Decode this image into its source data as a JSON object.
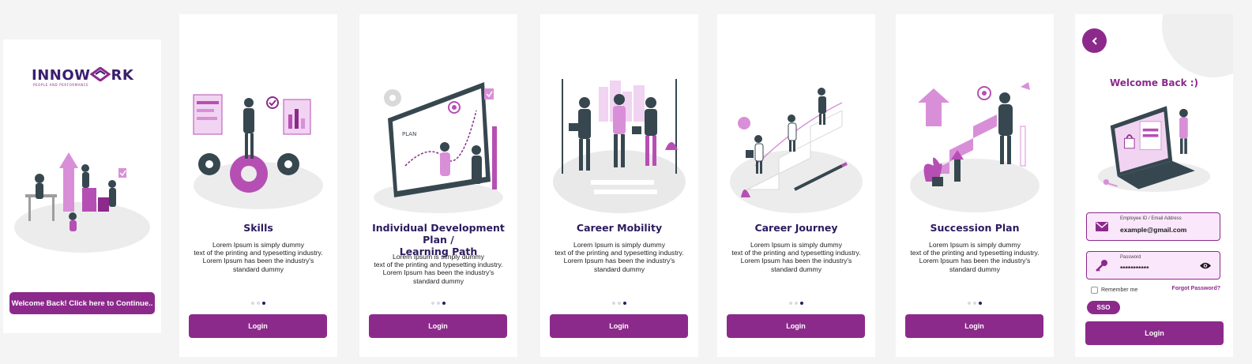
{
  "brand": {
    "logo_text_left": "INNOW",
    "logo_text_right": "RK",
    "tagline": "PEOPLE AND PERFORMANCE"
  },
  "splash": {
    "continue_label": "Welcome Back! Click here to Continue.."
  },
  "onboarding": [
    {
      "title": "Skills",
      "body": [
        "Lorem Ipsum is simply dummy",
        "text of the printing and typesetting industry.",
        "Lorem Ipsum has been the industry's",
        "standard dummy"
      ],
      "button": "Login",
      "illustration": "skills-illustration"
    },
    {
      "title_lines": [
        "Individual Development Plan /",
        "Learning Path"
      ],
      "body": [
        "Lorem Ipsum is simply dummy",
        "text of the printing and typesetting industry.",
        "Lorem Ipsum has been the industry's",
        "standard dummy"
      ],
      "button": "Login",
      "illustration": "learning-path-illustration",
      "board_label": "PLAN"
    },
    {
      "title": "Career Mobility",
      "body": [
        "Lorem Ipsum is simply dummy",
        "text of the printing and typesetting industry.",
        "Lorem Ipsum has been the industry's",
        "standard dummy"
      ],
      "button": "Login",
      "illustration": "career-mobility-illustration"
    },
    {
      "title": "Career Journey",
      "body": [
        "Lorem Ipsum is simply dummy",
        "text of the printing and typesetting industry.",
        "Lorem Ipsum has been the industry's",
        "standard dummy"
      ],
      "button": "Login",
      "illustration": "career-journey-illustration"
    },
    {
      "title": "Succession Plan",
      "body": [
        "Lorem Ipsum is simply dummy",
        "text of the printing and typesetting industry.",
        "Lorem Ipsum has been the industry's",
        "standard dummy"
      ],
      "button": "Login",
      "illustration": "succession-plan-illustration"
    }
  ],
  "pager": {
    "count": 3,
    "active_index": 2
  },
  "login": {
    "back_icon": "chevron-left-icon",
    "title": "Welcome Back :)",
    "email_label": "Employee ID / Email Address",
    "email_value": "example@gmail.com",
    "email_icon": "mail-icon",
    "password_label": "Password",
    "password_value": "***********",
    "password_icon": "key-icon",
    "visibility_icon": "eye-icon",
    "remember_label": "Remember me",
    "forgot_label": "Forgot Password?",
    "sso_label": "SSO",
    "login_label": "Login"
  },
  "colors": {
    "accent": "#8c2a8b",
    "title": "#2b1b5e",
    "field_bg": "#fbe7fb",
    "illustration_light": "#e8c6ec",
    "illustration_dark": "#37474f"
  }
}
